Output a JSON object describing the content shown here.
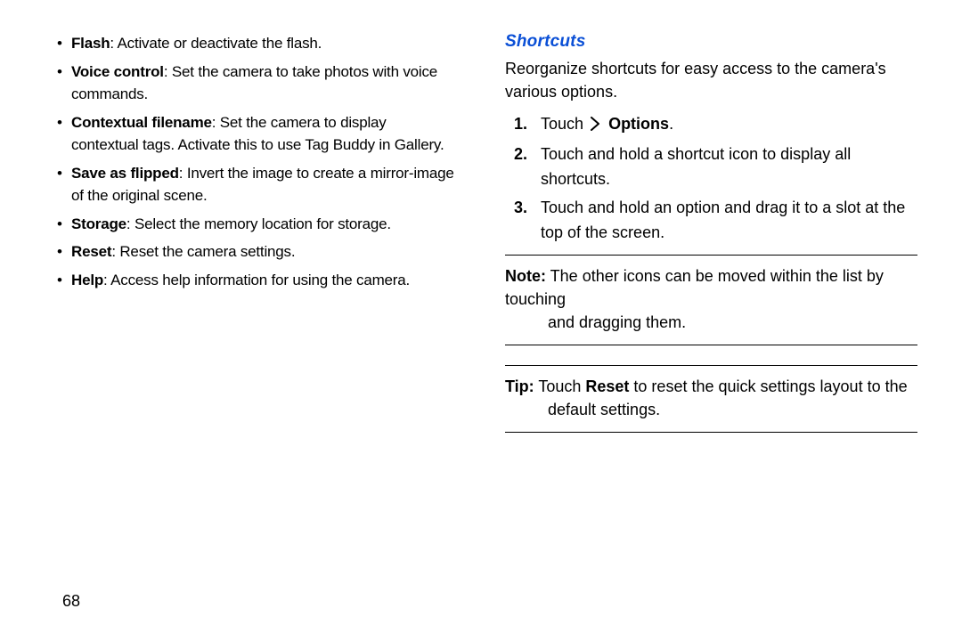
{
  "page_number": "68",
  "left": {
    "items": [
      {
        "term": "Flash",
        "desc": ": Activate or deactivate the flash."
      },
      {
        "term": "Voice control",
        "desc": ": Set the camera to take photos with voice commands."
      },
      {
        "term": "Contextual filename",
        "desc": ": Set the camera to display contextual tags. Activate this to use Tag Buddy in Gallery."
      },
      {
        "term": "Save as flipped",
        "desc": ": Invert the image to create a mirror-image of the original scene."
      },
      {
        "term": "Storage",
        "desc": ": Select the memory location for storage."
      },
      {
        "term": "Reset",
        "desc": ": Reset the camera settings."
      },
      {
        "term": "Help",
        "desc": ": Access help information for using the camera."
      }
    ]
  },
  "right": {
    "heading": "Shortcuts",
    "intro": "Reorganize shortcuts for easy access to the camera's various options.",
    "step1_prefix": "Touch ",
    "step1_bold": "Options",
    "step1_suffix": ".",
    "step2": "Touch and hold a shortcut icon to display all shortcuts.",
    "step3": "Touch and hold an option and drag it to a slot at the top of the screen.",
    "note_label": "Note:",
    "note_line1": " The other icons can be moved within the list by touching",
    "note_line2": "and dragging them.",
    "tip_label": "Tip:",
    "tip_prefix": " Touch ",
    "tip_bold": "Reset",
    "tip_line1_rest": " to reset the quick settings layout to the",
    "tip_line2": "default settings."
  }
}
